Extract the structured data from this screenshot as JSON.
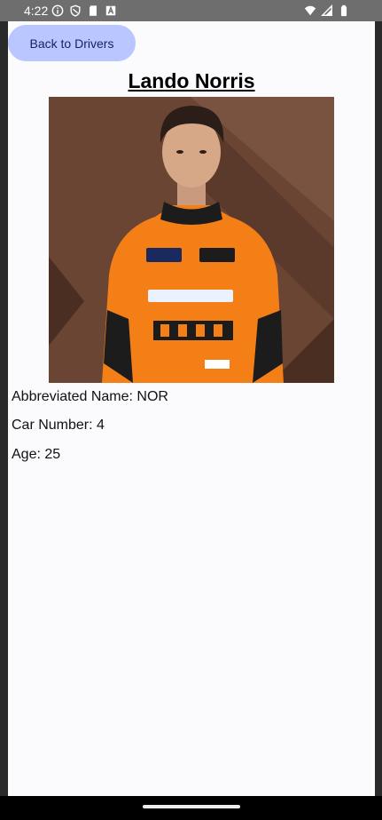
{
  "status_bar": {
    "time": "4:22",
    "left_icons": [
      "info-icon",
      "shield-icon",
      "sd-card-icon",
      "font-download-icon"
    ],
    "right_icons": [
      "wifi-icon",
      "signal-icon",
      "battery-icon"
    ]
  },
  "back_button": {
    "label": "Back to Drivers"
  },
  "driver": {
    "name": "Lando Norris",
    "photo_icon": "driver-portrait",
    "abbreviated_name": "Abbreviated Name: NOR",
    "car_number": "Car Number: 4",
    "age": "Age: 25"
  },
  "colors": {
    "button_bg": "#b9c6ff",
    "button_text": "#17215f",
    "photo_bg": "#6b4533",
    "suit_orange": "#f57f17"
  }
}
